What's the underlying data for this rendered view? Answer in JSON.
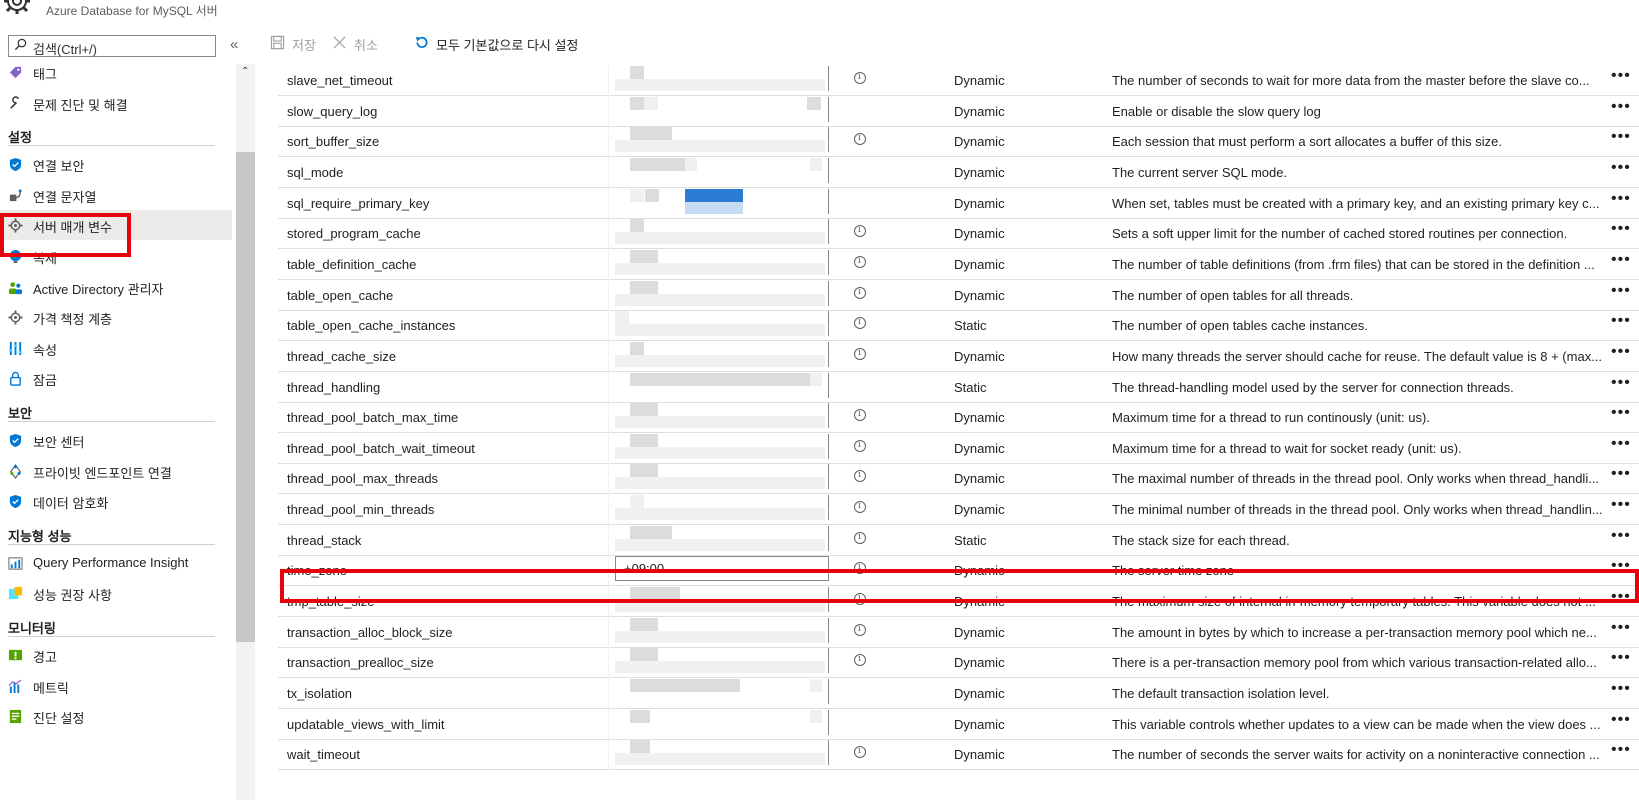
{
  "header": {
    "subtitle": "Azure Database for MySQL 서버"
  },
  "sidebar": {
    "search_placeholder": "검색(Ctrl+/)",
    "collapse_glyph": "«",
    "items_top": [
      {
        "label": "태그",
        "icon": "tag-icon"
      },
      {
        "label": "문제 진단 및 해결",
        "icon": "wrench-icon"
      }
    ],
    "sections": [
      {
        "title": "설정",
        "items": [
          {
            "label": "연결 보안",
            "icon": "shield-icon"
          },
          {
            "label": "연결 문자열",
            "icon": "connection-string-icon"
          },
          {
            "label": "서버 매개 변수",
            "icon": "gear-icon"
          },
          {
            "label": "복제",
            "icon": "globe-icon"
          },
          {
            "label": "Active Directory 관리자",
            "icon": "users-icon"
          },
          {
            "label": "가격 책정 계층",
            "icon": "gear-icon"
          },
          {
            "label": "속성",
            "icon": "properties-icon"
          },
          {
            "label": "잠금",
            "icon": "lock-icon"
          }
        ]
      },
      {
        "title": "보안",
        "items": [
          {
            "label": "보안 센터",
            "icon": "shield-icon"
          },
          {
            "label": "프라이빗 엔드포인트 연결",
            "icon": "endpoint-icon"
          },
          {
            "label": "데이터 암호화",
            "icon": "shield-icon"
          }
        ]
      },
      {
        "title": "지능형 성능",
        "items": [
          {
            "label": "Query Performance Insight",
            "icon": "chart-icon"
          },
          {
            "label": "성능 권장 사항",
            "icon": "recommendation-icon"
          }
        ]
      },
      {
        "title": "모니터링",
        "items": [
          {
            "label": "경고",
            "icon": "alert-icon"
          },
          {
            "label": "메트릭",
            "icon": "metrics-icon"
          },
          {
            "label": "진단 설정",
            "icon": "diagnostics-icon"
          }
        ]
      }
    ]
  },
  "toolbar": {
    "save_label": "저장",
    "cancel_label": "취소",
    "reset_label": "모두 기본값으로 다시 설정"
  },
  "params": [
    {
      "name": "slave_net_timeout",
      "type": "Dynamic",
      "desc": "The number of seconds to wait for more data from the master before the slave co...",
      "info": true
    },
    {
      "name": "slow_query_log",
      "type": "Dynamic",
      "desc": "Enable or disable the slow query log",
      "info": false
    },
    {
      "name": "sort_buffer_size",
      "type": "Dynamic",
      "desc": "Each session that must perform a sort allocates a buffer of this size.",
      "info": true
    },
    {
      "name": "sql_mode",
      "type": "Dynamic",
      "desc": "The current server SQL mode.",
      "info": false
    },
    {
      "name": "sql_require_primary_key",
      "type": "Dynamic",
      "desc": "When set, tables must be created with a primary key, and an existing primary key c...",
      "info": false
    },
    {
      "name": "stored_program_cache",
      "type": "Dynamic",
      "desc": "Sets a soft upper limit for the number of cached stored routines per connection.",
      "info": true
    },
    {
      "name": "table_definition_cache",
      "type": "Dynamic",
      "desc": "The number of table definitions (from .frm files) that can be stored in the definition ...",
      "info": true
    },
    {
      "name": "table_open_cache",
      "type": "Dynamic",
      "desc": "The number of open tables for all threads.",
      "info": true
    },
    {
      "name": "table_open_cache_instances",
      "type": "Static",
      "desc": "The number of open tables cache instances.",
      "info": true
    },
    {
      "name": "thread_cache_size",
      "type": "Dynamic",
      "desc": "How many threads the server should cache for reuse. The default value is 8 + (max...",
      "info": true
    },
    {
      "name": "thread_handling",
      "type": "Static",
      "desc": "The thread-handling model used by the server for connection threads.",
      "info": false
    },
    {
      "name": "thread_pool_batch_max_time",
      "type": "Dynamic",
      "desc": "Maximum time for a thread to run continously (unit: us).",
      "info": true
    },
    {
      "name": "thread_pool_batch_wait_timeout",
      "type": "Dynamic",
      "desc": "Maximum time for a thread to wait for socket ready (unit: us).",
      "info": true
    },
    {
      "name": "thread_pool_max_threads",
      "type": "Dynamic",
      "desc": "The maximal number of threads in the thread pool. Only works when thread_handli...",
      "info": true
    },
    {
      "name": "thread_pool_min_threads",
      "type": "Dynamic",
      "desc": "The minimal number of threads in the thread pool. Only works when thread_handlin...",
      "info": true
    },
    {
      "name": "thread_stack",
      "type": "Static",
      "desc": "The stack size for each thread.",
      "info": true
    },
    {
      "name": "time_zone",
      "type": "Dynamic",
      "desc": "The server time zone",
      "info": true,
      "value": "+09:00"
    },
    {
      "name": "tmp_table_size",
      "type": "Dynamic",
      "desc": "The maximum size of internal in-memory temporary tables. This variable does not ...",
      "info": true
    },
    {
      "name": "transaction_alloc_block_size",
      "type": "Dynamic",
      "desc": "The amount in bytes by which to increase a per-transaction memory pool which ne...",
      "info": true
    },
    {
      "name": "transaction_prealloc_size",
      "type": "Dynamic",
      "desc": "There is a per-transaction memory pool from which various transaction-related allo...",
      "info": true
    },
    {
      "name": "tx_isolation",
      "type": "Dynamic",
      "desc": "The default transaction isolation level.",
      "info": false
    },
    {
      "name": "updatable_views_with_limit",
      "type": "Dynamic",
      "desc": "This variable controls whether updates to a view can be made when the view does ...",
      "info": false
    },
    {
      "name": "wait_timeout",
      "type": "Dynamic",
      "desc": "The number of seconds the server waits for activity on a noninteractive connection ...",
      "info": true
    }
  ],
  "highlight_color": "#e8000b",
  "accent_color": "#0078d4"
}
